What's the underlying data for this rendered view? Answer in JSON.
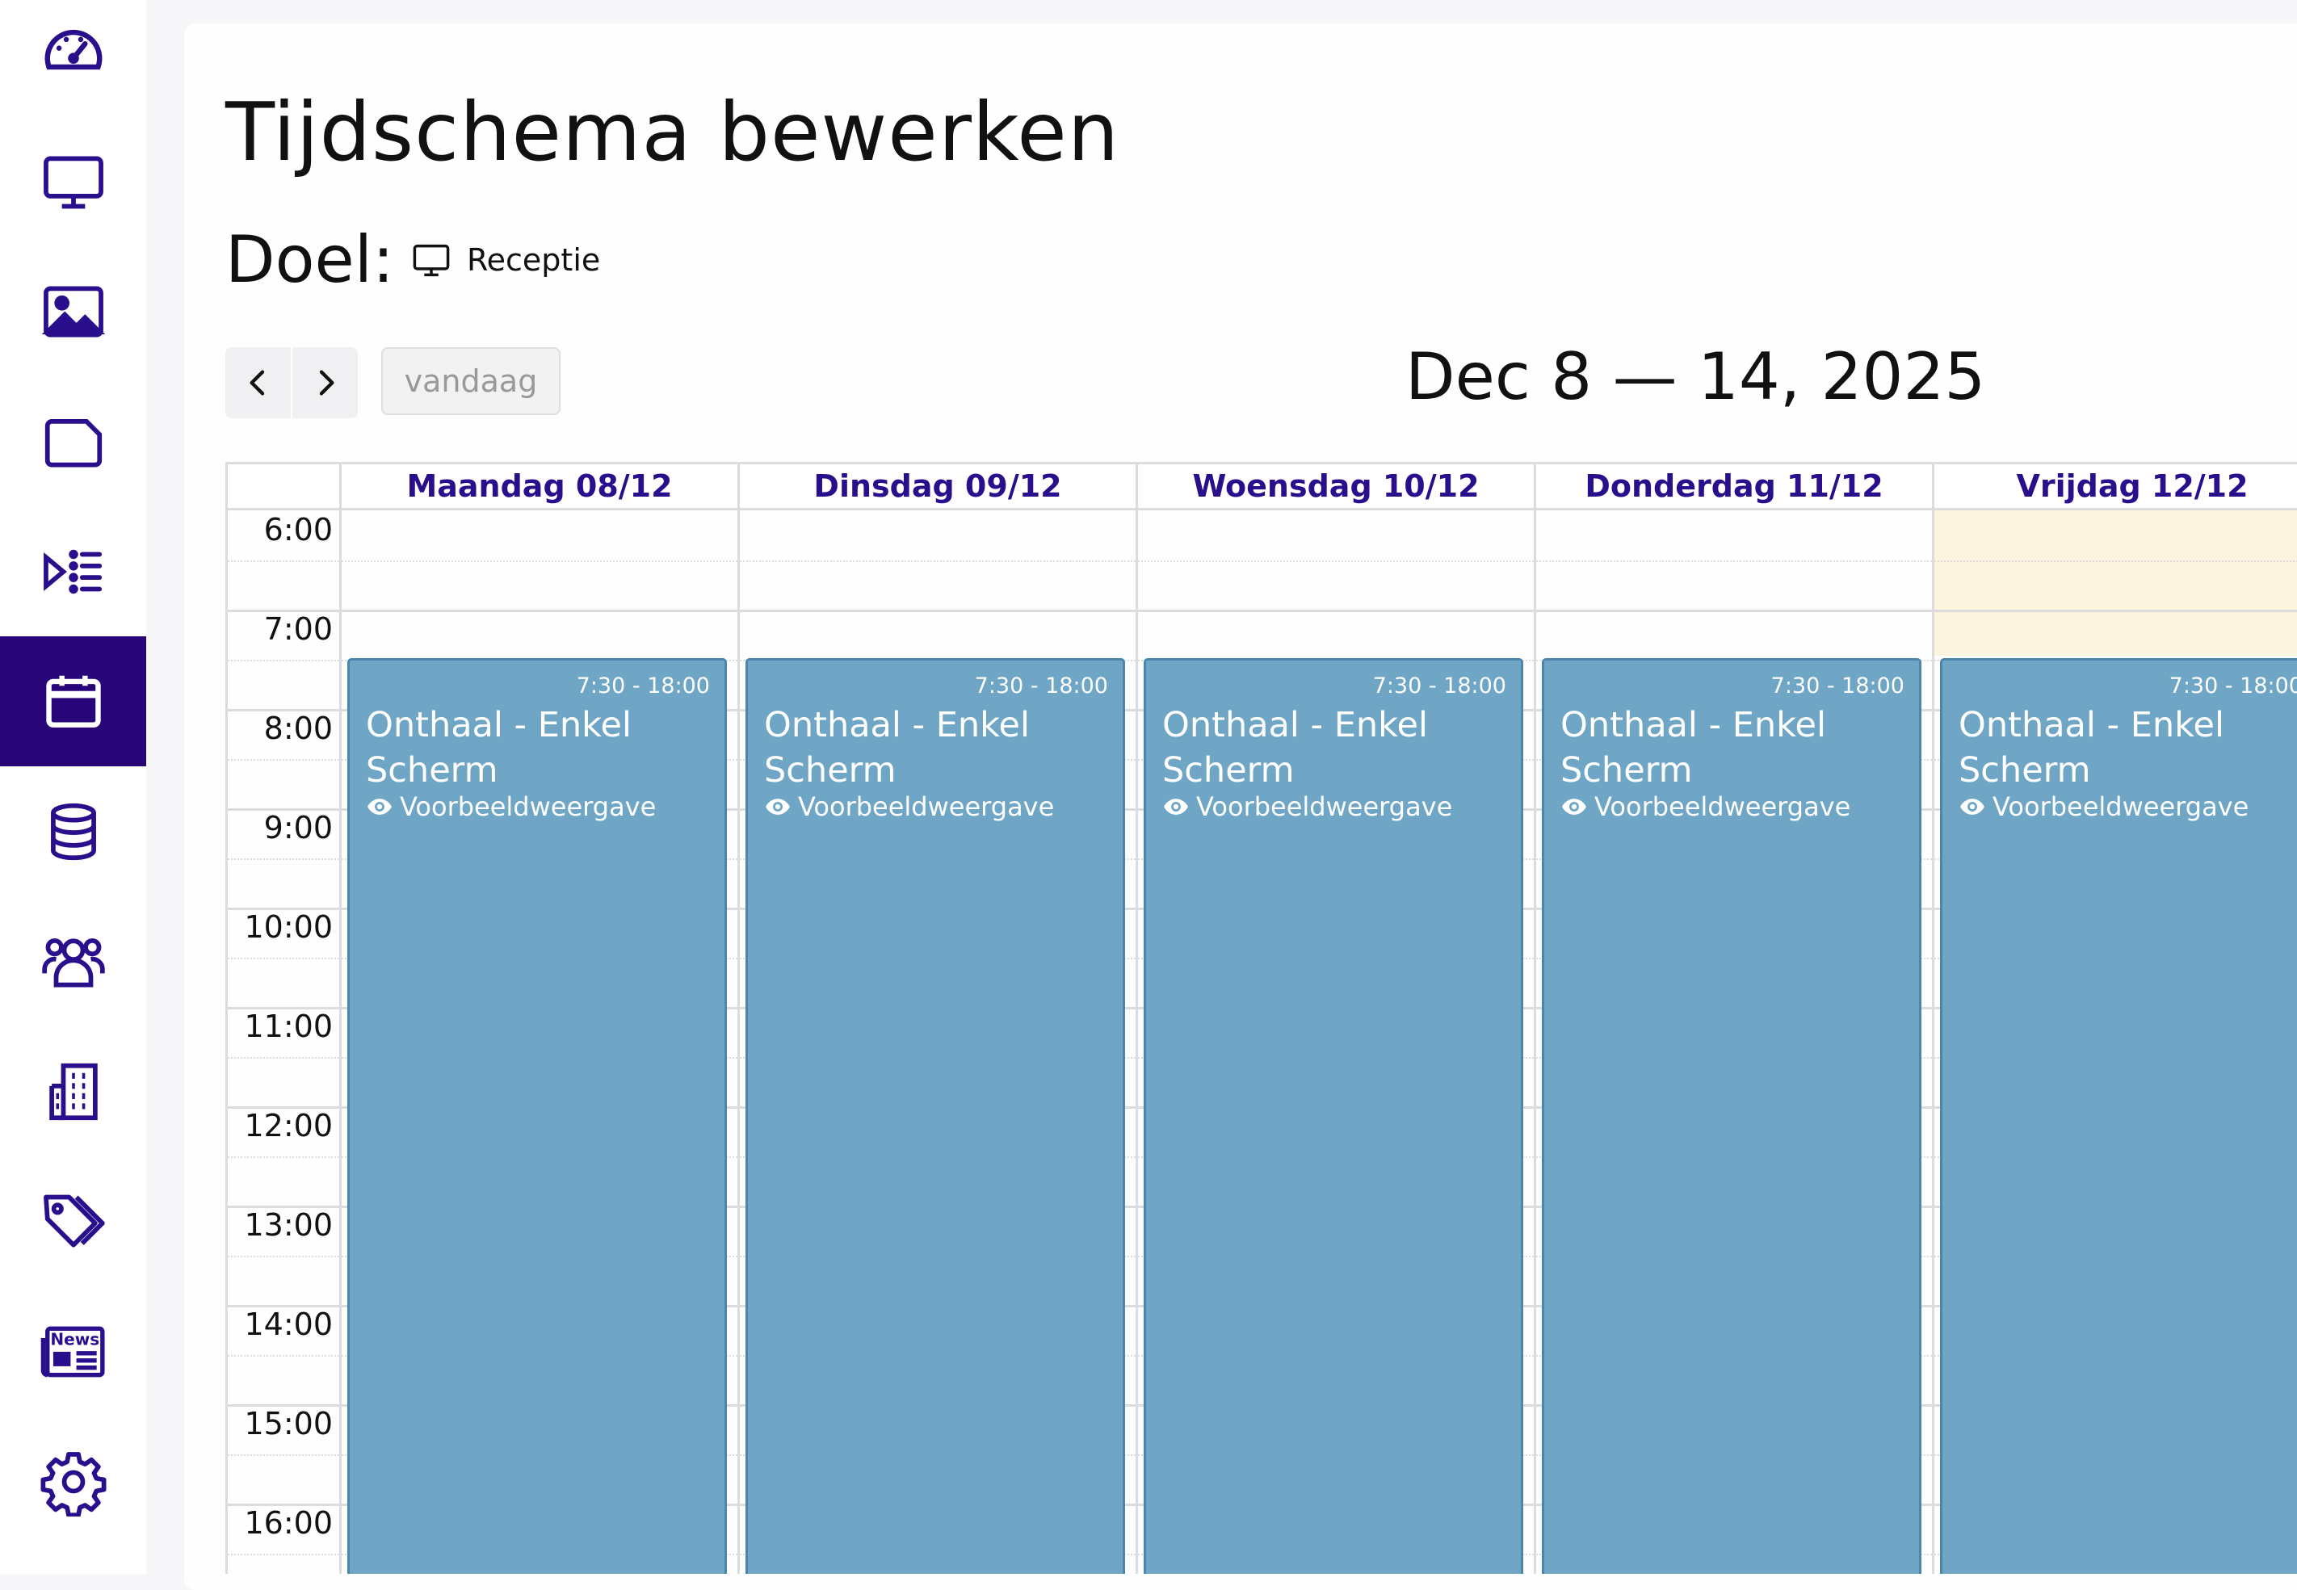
{
  "sidebar": {
    "items": [
      {
        "icon": "dashboard-gauge-icon",
        "active": false
      },
      {
        "icon": "monitor-icon",
        "active": false
      },
      {
        "icon": "image-icon",
        "active": false
      },
      {
        "icon": "folder-icon",
        "active": false
      },
      {
        "icon": "playlist-icon",
        "active": false
      },
      {
        "icon": "calendar-icon",
        "active": true
      },
      {
        "icon": "database-icon",
        "active": false
      },
      {
        "icon": "users-icon",
        "active": false
      },
      {
        "icon": "building-icon",
        "active": false
      },
      {
        "icon": "tags-icon",
        "active": false
      },
      {
        "icon": "news-icon",
        "active": false
      },
      {
        "icon": "gear-icon",
        "active": false
      }
    ],
    "active_color": "#28067a",
    "icon_color": "#2a0f8c"
  },
  "page": {
    "title": "Tijdschema bewerken",
    "target_label": "Doel:",
    "target_icon": "monitor-icon",
    "target_name": "Receptie"
  },
  "toolbar": {
    "prev_icon": "chevron-left-icon",
    "next_icon": "chevron-right-icon",
    "today_label": "vandaag",
    "date_range": "Dec 8 — 14, 2025"
  },
  "calendar": {
    "days": [
      {
        "label": "Maandag 08/12",
        "today": false
      },
      {
        "label": "Dinsdag 09/12",
        "today": false
      },
      {
        "label": "Woensdag 10/12",
        "today": false
      },
      {
        "label": "Donderdag 11/12",
        "today": false
      },
      {
        "label": "Vrijdag 12/12",
        "today": true
      }
    ],
    "hours": [
      "6:00",
      "7:00",
      "8:00",
      "9:00",
      "10:00",
      "11:00",
      "12:00",
      "13:00",
      "14:00",
      "15:00",
      "16:00"
    ],
    "today_color": "#fdf4df",
    "header_color": "#2a0f8c",
    "events": [
      {
        "time": "7:30 - 18:00",
        "title": "Onthaal - Enkel Scherm",
        "preview": "Voorbeeldweergave"
      },
      {
        "time": "7:30 - 18:00",
        "title": "Onthaal - Enkel Scherm",
        "preview": "Voorbeeldweergave"
      },
      {
        "time": "7:30 - 18:00",
        "title": "Onthaal - Enkel Scherm",
        "preview": "Voorbeeldweergave"
      },
      {
        "time": "7:30 - 18:00",
        "title": "Onthaal - Enkel Scherm",
        "preview": "Voorbeeldweergave"
      },
      {
        "time": "7:30 - 18:00",
        "title": "Onthaal - Enkel Scherm",
        "preview": "Voorbeeldweergave"
      }
    ],
    "event_color": "#6fa6c6"
  }
}
